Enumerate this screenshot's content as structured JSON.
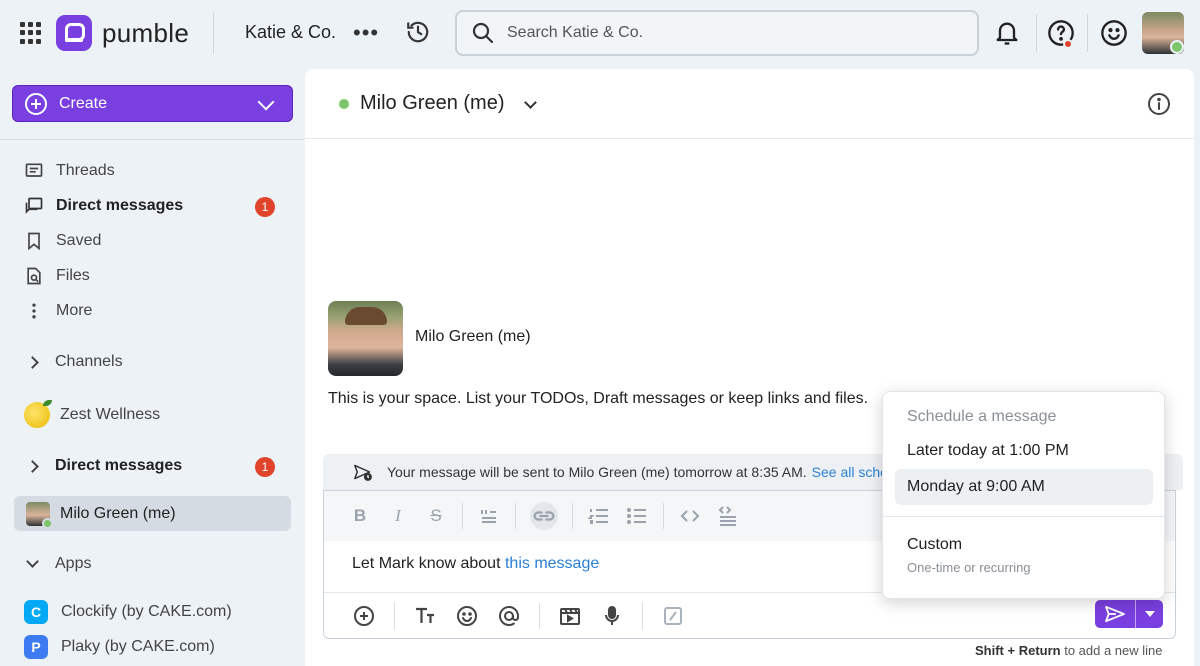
{
  "topbar": {
    "logo_text": "pumble",
    "workspace": "Katie & Co.",
    "more_label": "•••",
    "search_placeholder": "Search Katie & Co."
  },
  "sidebar": {
    "create_label": "Create",
    "nav": [
      {
        "label": "Threads",
        "icon": "threads-icon"
      },
      {
        "label": "Direct messages",
        "icon": "direct-messages-icon",
        "badge": "1"
      },
      {
        "label": "Saved",
        "icon": "bookmark-icon"
      },
      {
        "label": "Files",
        "icon": "files-icon"
      },
      {
        "label": "More",
        "icon": "more-vertical-icon"
      }
    ],
    "channels_label": "Channels",
    "zest_label": "Zest Wellness",
    "dm_section_label": "Direct messages",
    "dm_section_badge": "1",
    "dm_active_label": "Milo Green (me)",
    "apps_label": "Apps",
    "apps": [
      {
        "label": "Clockify (by CAKE.com)",
        "color": "#03a9f4"
      },
      {
        "label": "Plaky (by CAKE.com)",
        "color": "#3d7bf3"
      }
    ]
  },
  "main": {
    "header_title": "Milo Green (me)",
    "intro_name": "Milo Green (me)",
    "intro_text": "This is your space. List your TODOs, Draft messages or keep links and files."
  },
  "composer": {
    "notice_text": "Your message will be sent to Milo Green (me) tomorrow at 8:35 AM.",
    "notice_link": "See all sche",
    "message_prefix": "Let Mark know about ",
    "message_link": "this message",
    "shortcut_key": "Shift + Return",
    "shortcut_text": " to add a new line"
  },
  "schedule": {
    "title": "Schedule a message",
    "options": [
      "Later today at 1:00 PM",
      "Monday at 9:00 AM"
    ],
    "custom_label": "Custom",
    "custom_sub": "One-time or recurring"
  },
  "colors": {
    "brand": "#7a3fe0",
    "badge": "#e0452b",
    "online": "#7cc56a",
    "link": "#2a7fd4"
  }
}
